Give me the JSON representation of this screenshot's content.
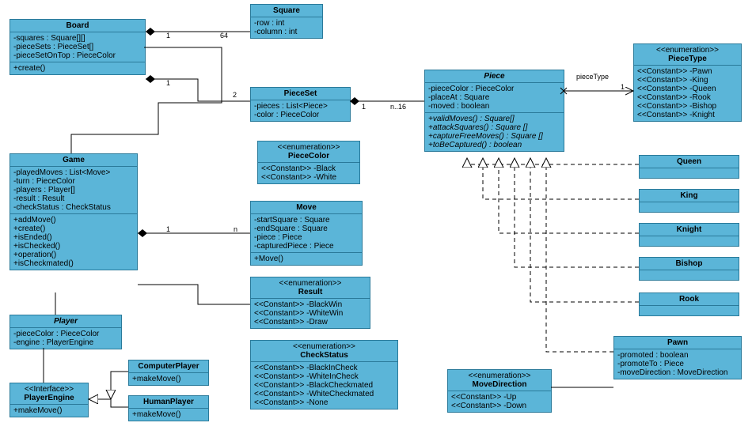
{
  "Board": {
    "name": "Board",
    "attrs": [
      "-squares : Square[][]",
      "-pieceSets : PieceSet[]",
      "-pieceSetOnTop : PieceColor"
    ],
    "ops": [
      "+create()"
    ]
  },
  "Square": {
    "name": "Square",
    "attrs": [
      "-row : int",
      "-column : int"
    ]
  },
  "PieceSet": {
    "name": "PieceSet",
    "attrs": [
      "-pieces : List<Piece>",
      "-color : PieceColor"
    ]
  },
  "Piece": {
    "name": "Piece",
    "attrs": [
      "-pieceColor : PieceColor",
      "-placeAt : Square",
      "-moved : boolean"
    ],
    "ops": [
      "+validMoves() : Square[]",
      "+attackSquares() : Square []",
      "+captureFreeMoves() : Square []",
      "+toBeCaptured() : boolean"
    ]
  },
  "PieceType": {
    "stereo": "<<enumeration>>",
    "name": "PieceType",
    "literals": [
      "<<Constant>>  -Pawn",
      "<<Constant>>  -King",
      "<<Constant>>  -Queen",
      "<<Constant>>  -Rook",
      "<<Constant>>  -Bishop",
      "<<Constant>>  -Knight"
    ]
  },
  "PieceColor": {
    "stereo": "<<enumeration>>",
    "name": "PieceColor",
    "literals": [
      "<<Constant>>  -Black",
      "<<Constant>>  -White"
    ]
  },
  "Move": {
    "name": "Move",
    "attrs": [
      "-startSquare : Square",
      "-endSquare : Square",
      "-piece : Piece",
      "-capturedPiece : Piece"
    ],
    "ops": [
      "+Move()"
    ]
  },
  "Game": {
    "name": "Game",
    "attrs": [
      "-playedMoves : List<Move>",
      "-turn : PieceColor",
      "-players : Player[]",
      "-result : Result",
      "-checkStatus : CheckStatus"
    ],
    "ops": [
      "+addMove()",
      "+create()",
      "+isEnded()",
      "+isChecked()",
      "+operation()",
      "+isCheckmated()"
    ]
  },
  "Result": {
    "stereo": "<<enumeration>>",
    "name": "Result",
    "literals": [
      "<<Constant>>  -BlackWin",
      "<<Constant>>  -WhiteWin",
      "<<Constant>>  -Draw"
    ]
  },
  "CheckStatus": {
    "stereo": "<<enumeration>>",
    "name": "CheckStatus",
    "literals": [
      "<<Constant>>  -BlackInCheck",
      "<<Constant>>  -WhiteInCheck",
      "<<Constant>>  -BlackCheckmated",
      "<<Constant>>  -WhiteCheckmated",
      "<<Constant>>  -None"
    ]
  },
  "Player": {
    "name": "Player",
    "attrs": [
      "-pieceColor : PieceColor",
      "-engine : PlayerEngine"
    ]
  },
  "PlayerEngine": {
    "stereo": "<<Interface>>",
    "name": "PlayerEngine",
    "ops": [
      "+makeMove()"
    ]
  },
  "ComputerPlayer": {
    "name": "ComputerPlayer",
    "ops": [
      "+makeMove()"
    ]
  },
  "HumanPlayer": {
    "name": "HumanPlayer",
    "ops": [
      "+makeMove()"
    ]
  },
  "MoveDirection": {
    "stereo": "<<enumeration>>",
    "name": "MoveDirection",
    "literals": [
      "<<Constant>>  -Up",
      "<<Constant>>  -Down"
    ]
  },
  "Queen": {
    "name": "Queen"
  },
  "King": {
    "name": "King"
  },
  "Knight": {
    "name": "Knight"
  },
  "Bishop": {
    "name": "Bishop"
  },
  "Rook": {
    "name": "Rook"
  },
  "Pawn": {
    "name": "Pawn",
    "attrs": [
      "-promoted : boolean",
      "-promoteTo : Piece",
      "-moveDirection : MoveDirection"
    ]
  },
  "labels": {
    "one_a": "1",
    "sixtyfour": "64",
    "one_b": "1",
    "two": "2",
    "one_c": "1",
    "n1_16": "n..16",
    "pieceType": "pieceType",
    "one_d": "1",
    "one_e": "1",
    "n": "n"
  }
}
